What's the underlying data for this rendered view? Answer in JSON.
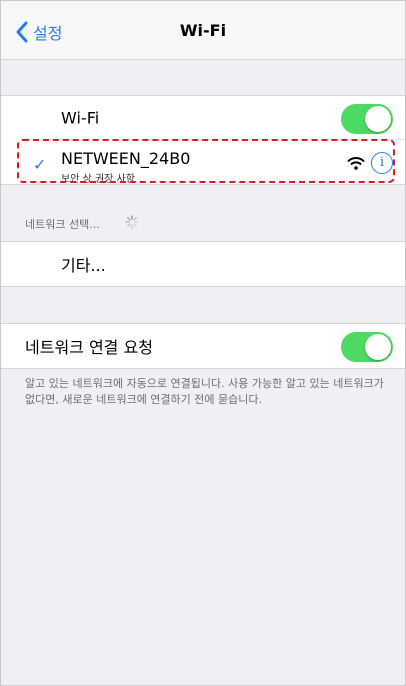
{
  "nav": {
    "back_label": "설정",
    "title": "Wi-Fi"
  },
  "wifi": {
    "label": "Wi-Fi",
    "enabled": true
  },
  "connected_network": {
    "name": "NETWEEN_24B0",
    "security_note": "보안 상 권장 사항",
    "selected": true
  },
  "network_select": {
    "header": "네트워크 선택..."
  },
  "other": {
    "label": "기타..."
  },
  "ask_to_join": {
    "label": "네트워크 연결 요청",
    "enabled": true,
    "description": "알고 있는 네트워크에 자동으로 연결됩니다. 사용 가능한 알고 있는 네트워크가 없다면, 새로운 네트워크에 연결하기 전에 묻습니다."
  },
  "colors": {
    "accent": "#2a7cf6",
    "toggle_on": "#4cd964",
    "highlight_border": "#e01b24",
    "background": "#efeff4"
  },
  "icons": {
    "back": "chevron-left-icon",
    "checkmark": "checkmark-icon",
    "wifi_signal": "wifi-signal-icon",
    "info": "info-icon",
    "spinner": "loading-spinner-icon"
  }
}
